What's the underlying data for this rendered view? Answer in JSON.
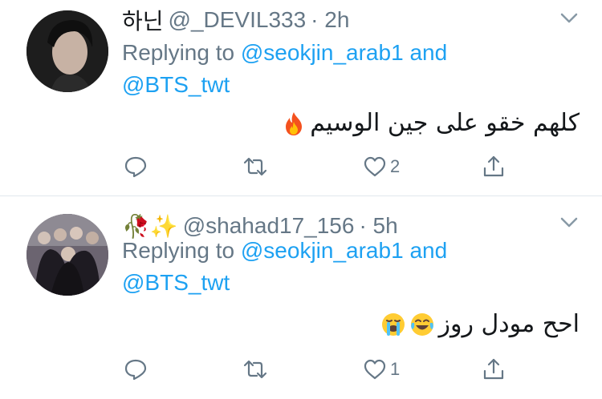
{
  "tweets": [
    {
      "name": "하닌",
      "handle": "@_DEVIL333",
      "time": "· 2h",
      "replying_prefix": "Replying to",
      "mention1": "@seokjin_arab1",
      "and": "and",
      "mention2": "@BTS_twt",
      "text": "كلهم خقو على جين الوسيم",
      "emoji": "fire-emoji",
      "reply_count": "",
      "retweet_count": "",
      "like_count": "2"
    },
    {
      "name": "🥀✨",
      "handle": "@shahad17_156",
      "time": "· 5h",
      "replying_prefix": "Replying to",
      "mention1": "@seokjin_arab1",
      "and": "and",
      "mention2": "@BTS_twt",
      "text": "احح مودل روز",
      "emoji": "laughing-crying-emojis",
      "reply_count": "",
      "retweet_count": "",
      "like_count": "1"
    }
  ],
  "colors": {
    "link": "#1da1f2",
    "secondary_text": "#657786",
    "primary_text": "#14171a",
    "divider": "#e1e8ed"
  },
  "icons": [
    "reply-icon",
    "retweet-icon",
    "like-icon",
    "share-icon",
    "chevron-down-icon"
  ]
}
